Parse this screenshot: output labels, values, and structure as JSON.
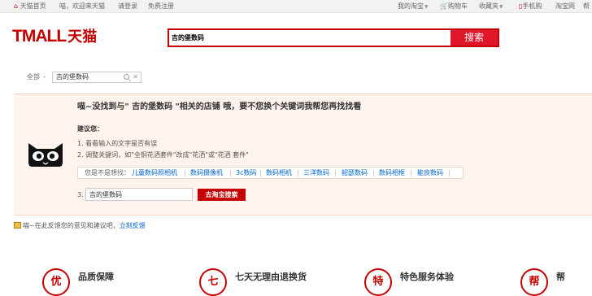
{
  "topbar": {
    "home": "天猫首页",
    "greeting": "喵，欢迎来天猫",
    "login": "请登录",
    "register": "免费注册",
    "my_taobao": "我的淘宝",
    "cart": "购物车",
    "favorites": "收藏夹",
    "mobile": "手机购",
    "taobao": "淘宝网",
    "help": "帮"
  },
  "header": {
    "logo_en": "TMALL",
    "logo_cn": "天猫",
    "search_value": "吉的堡数码",
    "search_button": "搜索"
  },
  "breadcrumb": {
    "all": "全部",
    "current": "吉的堡数码"
  },
  "result": {
    "message": "喵~没找到与\" 吉的堡数码 \"相关的店铺 哦，要不您换个关键词我帮您再找找看",
    "suggest_title": "建议您：",
    "tips": [
      "1. 看看输入的文字是否有误",
      "2. 调整关键词，如\"全铜花洒套件\"改成\"花洒\"或\"花洒 套件\""
    ],
    "related_label": "您是不是想找：",
    "related": [
      "儿童数码照相机",
      "数码摄像机",
      "3c数码",
      "数码相机",
      "三洋数码",
      "韶瑟数码",
      "数码相框",
      "能良数码"
    ],
    "retry_num": "3.",
    "retry_value": "吉的堡数码",
    "retry_button": "去淘宝搜索"
  },
  "feedback": {
    "text": "喵~在此反馈您的意见和建议吧，",
    "link": "立刻反馈"
  },
  "services": [
    {
      "icon": "优",
      "label": "品质保障"
    },
    {
      "icon": "七",
      "label": "七天无理由退换货"
    },
    {
      "icon": "特",
      "label": "特色服务体验"
    },
    {
      "icon": "帮",
      "label": "帮"
    }
  ],
  "colors": {
    "brand": "#c40000",
    "search_button": "#e0162b",
    "panel_bg": "#fff3ed",
    "link": "#0066cc"
  }
}
